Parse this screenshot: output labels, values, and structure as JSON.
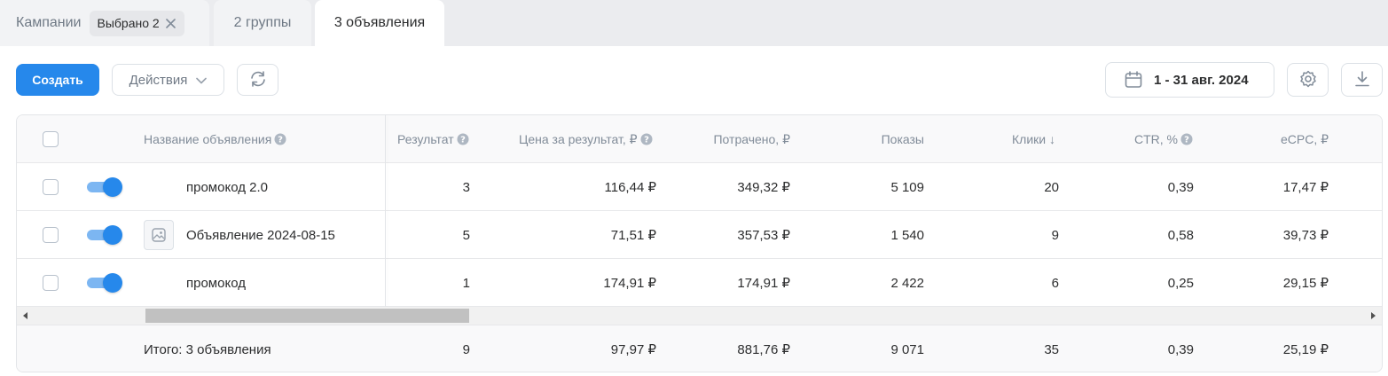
{
  "tabs": {
    "campaigns": "Кампании",
    "selected_chip": "Выбрано 2",
    "groups": "2 группы",
    "ads": "3 объявления"
  },
  "toolbar": {
    "create": "Создать",
    "actions": "Действия",
    "date_range": "1 - 31 авг. 2024"
  },
  "table": {
    "headers": {
      "name": "Название объявления",
      "result": "Результат",
      "cost_per_result": "Цена за результат, ₽",
      "spent": "Потрачено, ₽",
      "impressions": "Показы",
      "clicks": "Клики ↓",
      "ctr": "CTR, %",
      "ecpc": "eCPC, ₽"
    },
    "rows": [
      {
        "name": "промокод 2.0",
        "result": "3",
        "cost_per_result": "116,44 ₽",
        "spent": "349,32 ₽",
        "impressions": "5 109",
        "clicks": "20",
        "ctr": "0,39",
        "ecpc": "17,47 ₽"
      },
      {
        "name": "Объявление 2024-08-15",
        "result": "5",
        "cost_per_result": "71,51 ₽",
        "spent": "357,53 ₽",
        "impressions": "1 540",
        "clicks": "9",
        "ctr": "0,58",
        "ecpc": "39,73 ₽"
      },
      {
        "name": "промокод",
        "result": "1",
        "cost_per_result": "174,91 ₽",
        "spent": "174,91 ₽",
        "impressions": "2 422",
        "clicks": "6",
        "ctr": "0,25",
        "ecpc": "29,15 ₽"
      }
    ],
    "totals": {
      "label": "Итого: 3 объявления",
      "result": "9",
      "cost_per_result": "97,97 ₽",
      "spent": "881,76 ₽",
      "impressions": "9 071",
      "clicks": "35",
      "ctr": "0,39",
      "ecpc": "25,19 ₽"
    }
  },
  "colors": {
    "accent": "#2688eb",
    "toggle_track": "#7cb6f2",
    "header_text": "#818c99"
  },
  "icons": [
    "close-icon",
    "chevron-down-icon",
    "refresh-icon",
    "calendar-icon",
    "gear-icon",
    "download-icon",
    "help-icon",
    "image-placeholder-icon"
  ]
}
